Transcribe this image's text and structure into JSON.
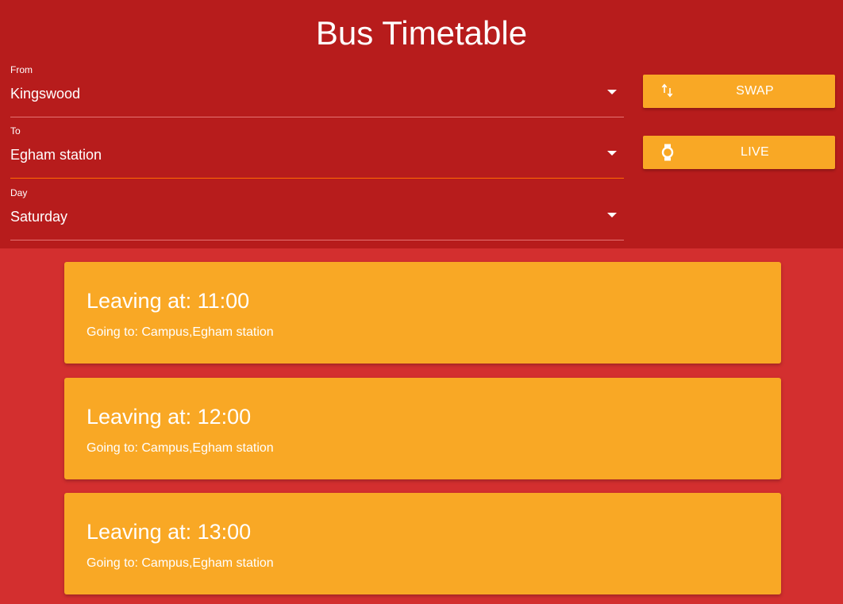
{
  "header": {
    "title": "Bus Timetable",
    "background": "#b71c1c"
  },
  "form": {
    "from": {
      "label": "From",
      "value": "Kingswood"
    },
    "to": {
      "label": "To",
      "value": "Egham station"
    },
    "day": {
      "label": "Day",
      "value": "Saturday"
    }
  },
  "buttons": {
    "swap": {
      "label": "SWAP",
      "icon": "swap-vertical-icon"
    },
    "live": {
      "label": "LIVE",
      "icon": "watch-icon"
    }
  },
  "departures": [
    {
      "time": "Leaving at: 11:00",
      "destination": "Going to: Campus,Egham station"
    },
    {
      "time": "Leaving at: 12:00",
      "destination": "Going to: Campus,Egham station"
    },
    {
      "time": "Leaving at: 13:00",
      "destination": "Going to: Campus,Egham station"
    }
  ],
  "colors": {
    "page_background": "#d32f2f",
    "accent": "#f9a825",
    "focus_underline": "#ff6d00"
  }
}
